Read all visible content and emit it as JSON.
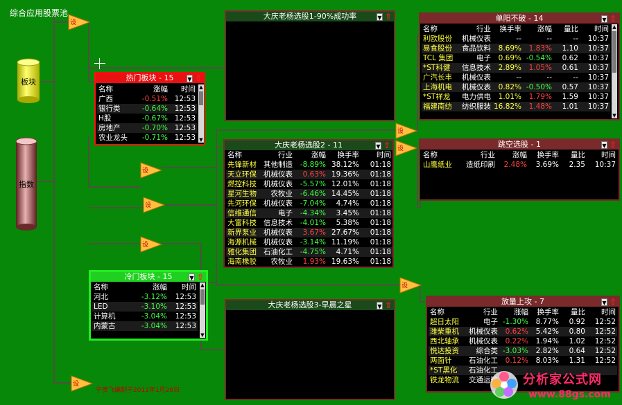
{
  "app": {
    "title": "综合应用股票池",
    "footer_note": "宁贵飞编制于2011年1月26日"
  },
  "sources": {
    "sector": {
      "label": "板块"
    },
    "index": {
      "label": "指数"
    }
  },
  "node_label": "设",
  "panels": {
    "hot_sectors": {
      "title": "热门板块 - 15",
      "columns": [
        "名称",
        "涨幅",
        "时间"
      ],
      "rows": [
        [
          "广西",
          "-0.51%",
          "12:53"
        ],
        [
          "银行类",
          "-0.64%",
          "12:53"
        ],
        [
          "H股",
          "-0.67%",
          "12:53"
        ],
        [
          "房地产",
          "-0.70%",
          "12:53"
        ],
        [
          "农业龙头",
          "-0.71%",
          "12:53"
        ]
      ]
    },
    "cold_sectors": {
      "title": "冷门板块 - 15",
      "columns": [
        "名称",
        "涨幅",
        "时间"
      ],
      "rows": [
        [
          "河北",
          "-3.12%",
          "12:53"
        ],
        [
          "LED",
          "-3.10%",
          "12:53"
        ],
        [
          "计算机",
          "-3.04%",
          "12:53"
        ],
        [
          "内蒙古",
          "-3.04%",
          "12:53"
        ]
      ]
    },
    "daqing1": {
      "title": "大庆老杨选股1-90%成功率"
    },
    "daqing3": {
      "title": "大庆老杨选股3-早晨之星"
    },
    "daqing2": {
      "title": "大庆老杨选股2 - 11",
      "columns": [
        "名称",
        "行业",
        "涨幅",
        "换手率",
        "时间"
      ],
      "rows": [
        [
          "先锋新材",
          "其他制造",
          "-8.89%",
          "38.12%",
          "01:18"
        ],
        [
          "天立环保",
          "机械仪表",
          "0.63%",
          "19.36%",
          "01:18"
        ],
        [
          "燃控科技",
          "机械仪表",
          "-5.57%",
          "12.01%",
          "01:18"
        ],
        [
          "星河生物",
          "农牧业",
          "-6.46%",
          "14.45%",
          "01:18"
        ],
        [
          "先河环保",
          "机械仪表",
          "-7.04%",
          "4.74%",
          "01:18"
        ],
        [
          "信维通信",
          "电子",
          "-4.34%",
          "3.45%",
          "01:18"
        ],
        [
          "大富科技",
          "信息技术",
          "-4.01%",
          "5.38%",
          "01:18"
        ],
        [
          "新界泵业",
          "机械仪表",
          "3.67%",
          "27.67%",
          "01:18"
        ],
        [
          "海源机械",
          "机械仪表",
          "-3.14%",
          "11.19%",
          "01:18"
        ],
        [
          "雅化集团",
          "石油化工",
          "-4.75%",
          "4.71%",
          "01:18"
        ],
        [
          "海南橡胶",
          "农牧业",
          "1.93%",
          "19.63%",
          "01:18"
        ]
      ]
    },
    "danyang": {
      "title": "单阳不破 - 14",
      "columns": [
        "名称",
        "行业",
        "换手率",
        "涨幅",
        "量比",
        "时间"
      ],
      "rows": [
        [
          "利欧股份",
          "机械仪表",
          "--",
          "--",
          "--",
          "10:37"
        ],
        [
          "易食股份",
          "食品饮料",
          "8.69%",
          "1.83%",
          "1.10",
          "10:37"
        ],
        [
          "TCL 集团",
          "电子",
          "0.69%",
          "-0.54%",
          "0.62",
          "10:37"
        ],
        [
          "*ST科健",
          "信息技术",
          "2.89%",
          "1.05%",
          "0.61",
          "10:37"
        ],
        [
          "广汽长丰",
          "机械仪表",
          "--",
          "--",
          "--",
          "10:37"
        ],
        [
          "上海机电",
          "机械仪表",
          "0.82%",
          "-0.50%",
          "0.57",
          "10:37"
        ],
        [
          "*ST祥龙",
          "电力供电",
          "1.01%",
          "1.79%",
          "1.59",
          "10:37"
        ],
        [
          "福建南纺",
          "纺织服装",
          "16.82%",
          "1.48%",
          "1.01",
          "10:37"
        ]
      ]
    },
    "gap_up": {
      "title": "跳空选股 - 1",
      "columns": [
        "名称",
        "行业",
        "涨幅",
        "换手率",
        "量比",
        "时间"
      ],
      "rows": [
        [
          "山鹰纸业",
          "造纸印刷",
          "2.48%",
          "3.69%",
          "2.35",
          "10:37"
        ]
      ]
    },
    "volume_up": {
      "title": "放量上攻 - 7",
      "columns": [
        "名称",
        "行业",
        "涨幅",
        "换手率",
        "量比",
        "时间"
      ],
      "rows": [
        [
          "超日太阳",
          "电子",
          "-1.30%",
          "8.77%",
          "0.92",
          "12:52"
        ],
        [
          "潍柴重机",
          "机械仪表",
          "0.62%",
          "5.42%",
          "0.80",
          "12:52"
        ],
        [
          "西北轴承",
          "机械仪表",
          "0.22%",
          "1.94%",
          "1.02",
          "12:52"
        ],
        [
          "悦达投资",
          "综合类",
          "-3.03%",
          "2.82%",
          "0.64",
          "12:52"
        ],
        [
          "两面针",
          "石油化工",
          "0.12%",
          "8.03%",
          "1.31",
          "12:52"
        ],
        [
          "*ST黑化",
          "石油化工",
          "",
          "",
          "",
          ""
        ],
        [
          "铁龙物流",
          "交通运输",
          "",
          "",
          "",
          ""
        ]
      ]
    }
  },
  "watermark": {
    "line1": "分析家公式网",
    "line2": "www.88gs.com"
  },
  "colors": {
    "background": "#088808",
    "hot_border": "#ff1010",
    "cold_border": "#20ee20",
    "panel_border": "#7a2a2a",
    "up": "#ff4040",
    "down": "#40ff40",
    "link": "#7a3060",
    "node_fill": "#ffc040"
  }
}
